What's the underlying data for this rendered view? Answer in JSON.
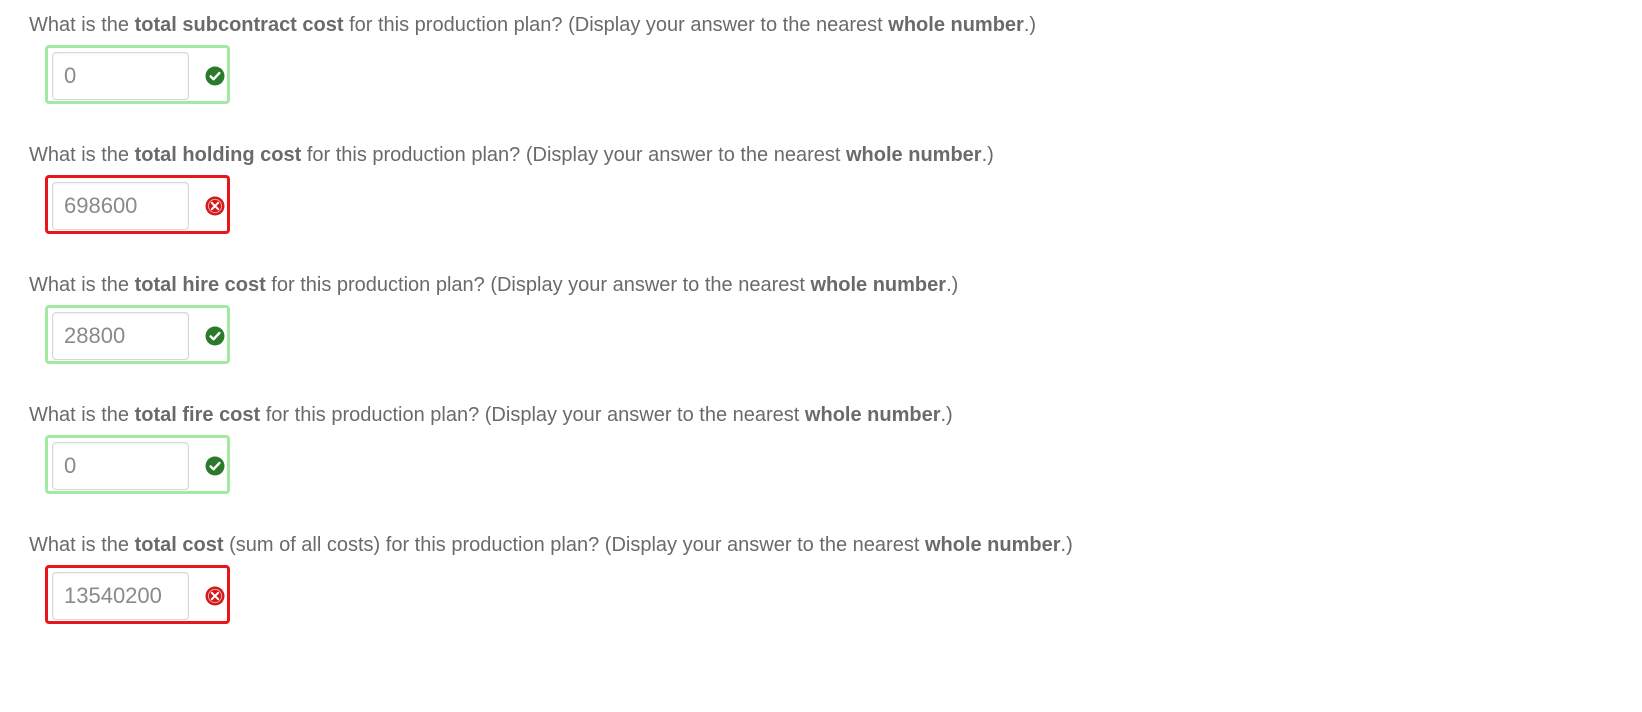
{
  "questions": [
    {
      "prefix": "What is the ",
      "bold": "total subcontract cost",
      "suffix": " for this production plan? (Display your answer to the nearest ",
      "bold2": "whole number",
      "end": ".)",
      "answer": "0",
      "status": "correct",
      "status_icon": "checkmark-circle-icon"
    },
    {
      "prefix": "What is the ",
      "bold": "total holding cost",
      "suffix": " for this production plan? (Display your answer to the nearest ",
      "bold2": "whole number",
      "end": ".)",
      "answer": "698600",
      "status": "incorrect",
      "status_icon": "x-circle-icon"
    },
    {
      "prefix": "What is the ",
      "bold": "total hire cost",
      "suffix": " for this production plan? (Display your answer to the nearest ",
      "bold2": "whole number",
      "end": ".)",
      "answer": "28800",
      "status": "correct",
      "status_icon": "checkmark-circle-icon"
    },
    {
      "prefix": "What is the ",
      "bold": "total fire cost",
      "suffix": " for this production plan? (Display your answer to the nearest ",
      "bold2": "whole number",
      "end": ".)",
      "answer": "0",
      "status": "correct",
      "status_icon": "checkmark-circle-icon"
    },
    {
      "prefix": "What is the ",
      "bold": "total cost",
      "suffix": " (sum of all costs) for this production plan? (Display your answer to the nearest ",
      "bold2": "whole number",
      "end": ".)",
      "answer": "13540200",
      "status": "incorrect",
      "status_icon": "x-circle-icon"
    }
  ],
  "colors": {
    "correct_border": "#a3e9a4",
    "incorrect_border": "#e8151a",
    "correct_icon": "#2b7a2b",
    "incorrect_icon": "#d21a1a",
    "text": "#6a6a6a"
  }
}
